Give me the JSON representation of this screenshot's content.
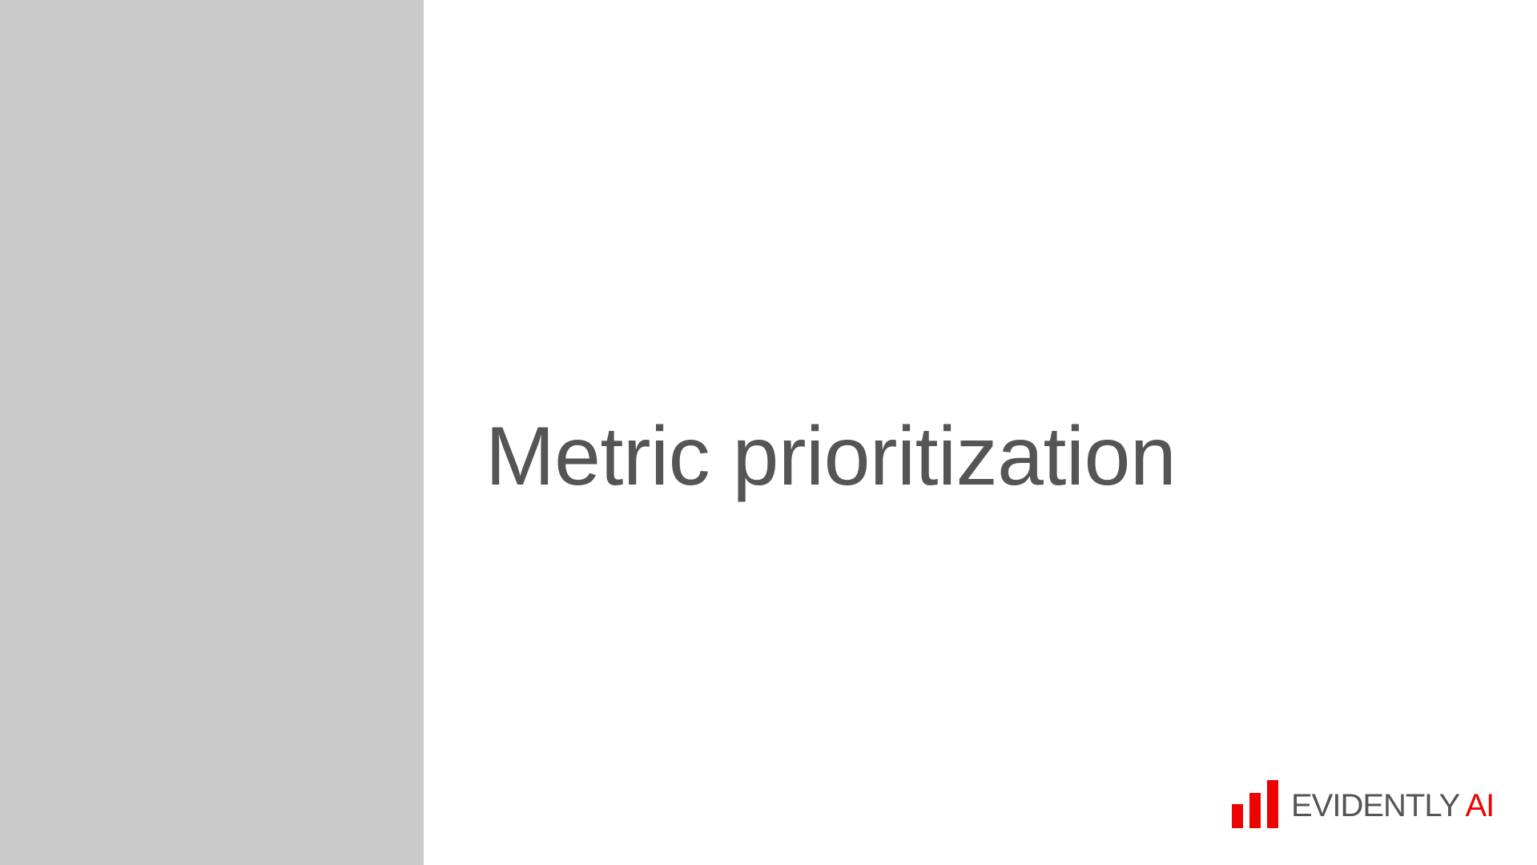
{
  "slide": {
    "title": "Metric prioritization"
  },
  "logo": {
    "word_1": "EVIDENTLY",
    "word_2": "AI",
    "icon": "bar-chart-icon",
    "accent_color": "#ed0400",
    "text_color": "#555555"
  },
  "colors": {
    "side_panel": "#cacaca",
    "background": "#ffffff",
    "title": "#555555"
  }
}
